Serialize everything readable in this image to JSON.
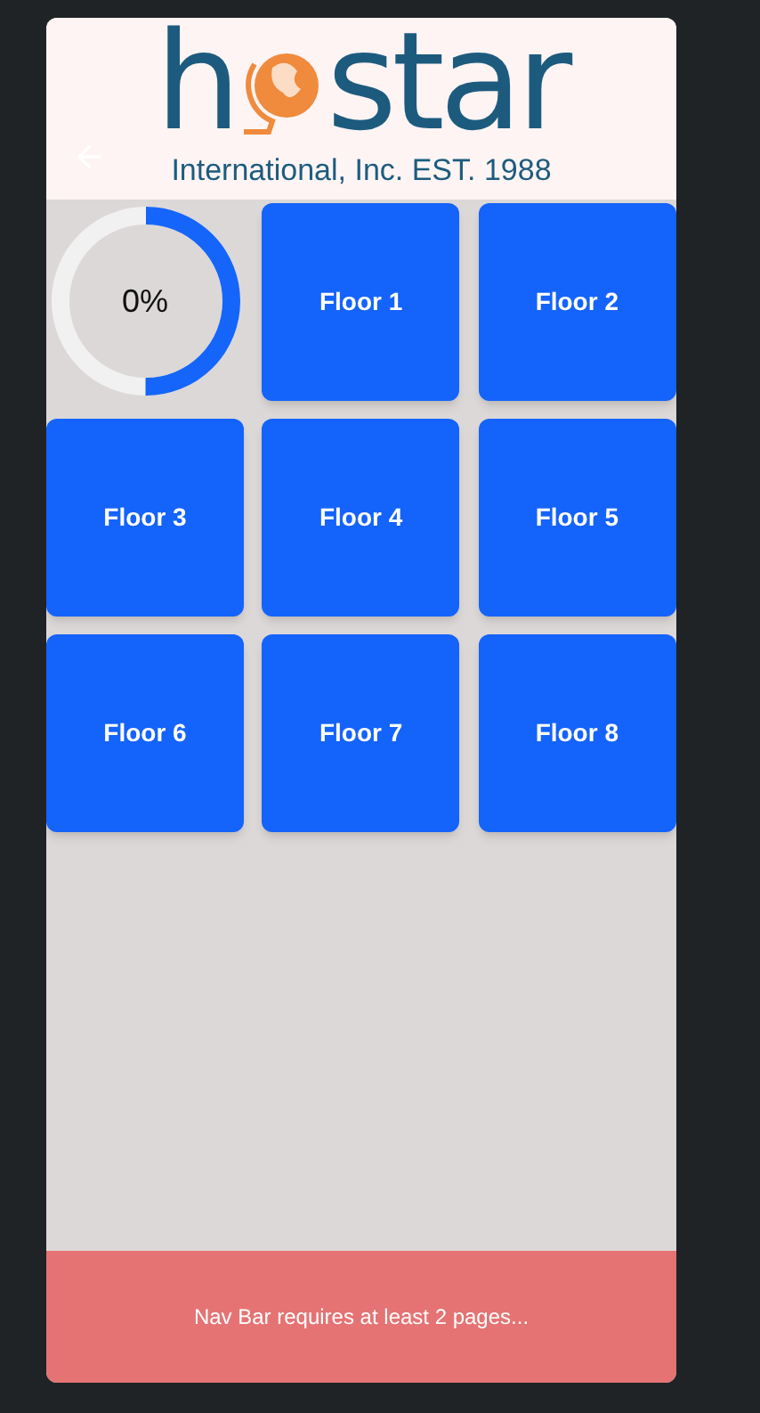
{
  "header": {
    "logo": {
      "left": "h",
      "right": "star",
      "tagline": "International, Inc. EST. 1988"
    }
  },
  "progress": {
    "label": "0%"
  },
  "floors": [
    {
      "label": "Floor 1"
    },
    {
      "label": "Floor 2"
    },
    {
      "label": "Floor 3"
    },
    {
      "label": "Floor 4"
    },
    {
      "label": "Floor 5"
    },
    {
      "label": "Floor 6"
    },
    {
      "label": "Floor 7"
    },
    {
      "label": "Floor 8"
    }
  ],
  "nav_bar": {
    "message": "Nav Bar requires at least 2 pages..."
  }
}
